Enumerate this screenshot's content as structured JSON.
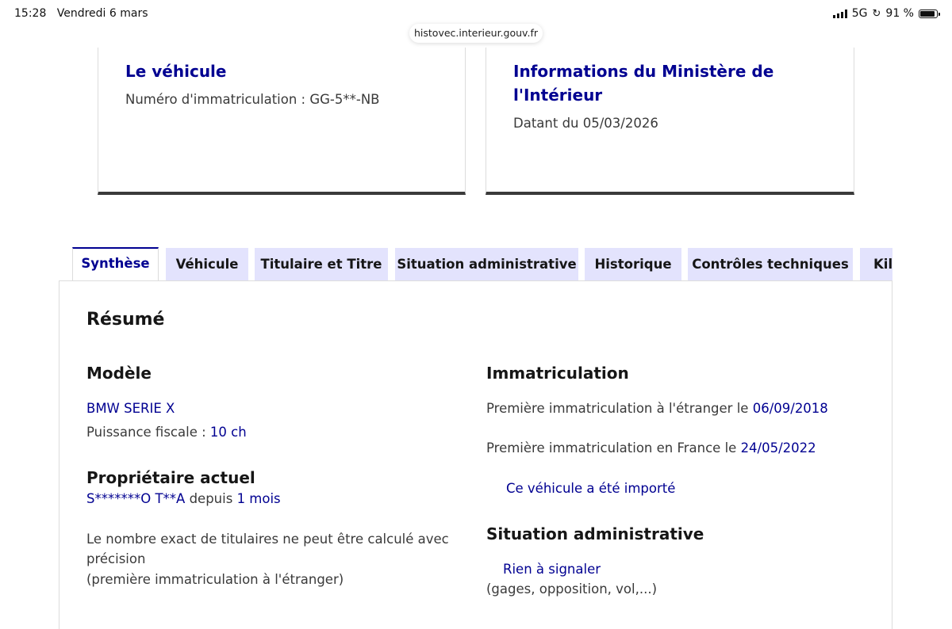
{
  "status_bar": {
    "time": "15:28",
    "date": "Vendredi 6 mars",
    "network": "5G",
    "battery": "91 %",
    "battery_level": 0.91
  },
  "browser": {
    "url": "histovec.interieur.gouv.fr"
  },
  "cards": {
    "vehicle": {
      "title": "Le véhicule",
      "plate_label": "Numéro d'immatriculation : GG-5**-NB"
    },
    "ministry": {
      "title": "Informations du Ministère de l'Intérieur",
      "date_label": "Datant du 05/03/2026"
    }
  },
  "tabs": [
    {
      "label": "Synthèse",
      "active": true
    },
    {
      "label": "Véhicule",
      "active": false
    },
    {
      "label": "Titulaire et Titre",
      "active": false
    },
    {
      "label": "Situation administrative",
      "active": false
    },
    {
      "label": "Historique",
      "active": false
    },
    {
      "label": "Contrôles techniques",
      "active": false
    },
    {
      "label": "Kilométrage",
      "active": false
    }
  ],
  "summary": {
    "title": "Résumé",
    "model": {
      "heading": "Modèle",
      "name": "BMW SERIE X",
      "power_label": "Puissance fiscale : ",
      "power_value": "10 ch"
    },
    "owner": {
      "heading": "Propriétaire actuel",
      "name": "S*******O T**A",
      "since_label": " depuis ",
      "since_value": "1 mois",
      "note_line1": "Le nombre exact de titulaires ne peut être calculé avec",
      "note_line2": "précision",
      "note_line3": "(première immatriculation à l'étranger)"
    },
    "registration": {
      "heading": "Immatriculation",
      "foreign_label": "Première immatriculation à l'étranger le ",
      "foreign_date": "06/09/2018",
      "france_label": "Première immatriculation en France le ",
      "france_date": "24/05/2022",
      "imported_note": "Ce véhicule a été importé"
    },
    "admin": {
      "heading": "Situation administrative",
      "status": "Rien à signaler",
      "detail": "(gages, opposition, vol,...)"
    }
  },
  "colors": {
    "accent": "#000091",
    "tab_bg": "#e3e3fd",
    "text": "#3a3a3a"
  }
}
